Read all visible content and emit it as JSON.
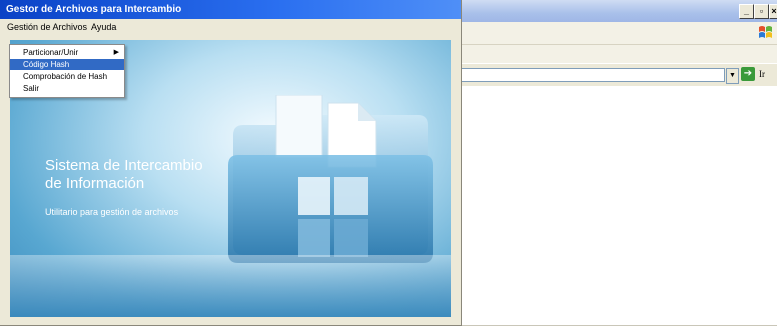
{
  "app": {
    "title": "Gestor de Archivos para Intercambio",
    "menu": [
      "Gestión de Archivos",
      "Ayuda"
    ],
    "dropdown": [
      {
        "label": "Particionar/Unir",
        "submenu": true,
        "selected": false
      },
      {
        "label": "Código Hash",
        "submenu": false,
        "selected": true
      },
      {
        "label": "Comprobación de Hash",
        "submenu": false,
        "selected": false
      },
      {
        "label": "Salir",
        "submenu": false,
        "selected": false
      }
    ],
    "splash": {
      "title_line1": "Sistema de Intercambio",
      "title_line2": "de Información",
      "subtitle": "Utilitario para gestión de archivos"
    }
  },
  "browser": {
    "window_buttons": [
      "_",
      "🗗",
      "×"
    ],
    "go_label": "Ir",
    "icons": [
      "windows-flag-icon",
      "dropdown-arrow-icon",
      "go-arrow-icon"
    ]
  },
  "colors": {
    "title_blue": "#0a42c6",
    "menu_highlight": "#316ac5",
    "splash_blue": "#58a7d1"
  }
}
